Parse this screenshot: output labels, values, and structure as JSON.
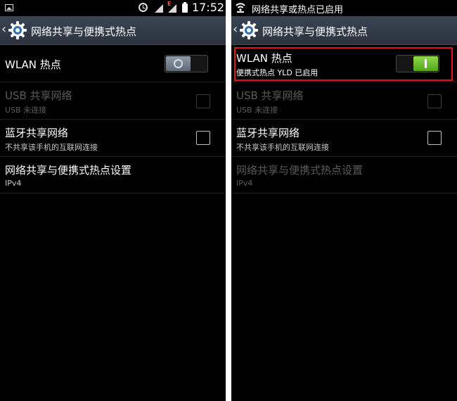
{
  "left_screen": {
    "status_bar": {
      "time": "17:52",
      "network_label": "E",
      "icons": [
        "image-notification-icon",
        "alarm-icon",
        "signal-icon",
        "battery-icon"
      ]
    },
    "action_bar": {
      "title": "网络共享与便携式热点",
      "icon": "gear-icon"
    },
    "rows": [
      {
        "title": "WLAN 热点",
        "subtitle": "",
        "control": "toggle",
        "state": "off",
        "enabled": true
      },
      {
        "title": "USB 共享网络",
        "subtitle": "USB 未连接",
        "control": "checkbox",
        "checked": false,
        "enabled": false
      },
      {
        "title": "蓝牙共享网络",
        "subtitle": "不共享该手机的互联网连接",
        "control": "checkbox",
        "checked": false,
        "enabled": true
      },
      {
        "title": "网络共享与便携式热点设置",
        "subtitle": "IPv4",
        "control": "none",
        "enabled": true
      }
    ]
  },
  "right_screen": {
    "status_bar": {
      "notification_text": "网络共享或热点已启用",
      "icon": "wifi-hotspot-icon"
    },
    "action_bar": {
      "title": "网络共享与便携式热点",
      "icon": "gear-icon"
    },
    "rows": [
      {
        "title": "WLAN 热点",
        "subtitle": "便携式热点 YLD 已启用",
        "control": "toggle",
        "state": "on",
        "enabled": true
      },
      {
        "title": "USB 共享网络",
        "subtitle": "USB 未连接",
        "control": "checkbox",
        "checked": false,
        "enabled": false
      },
      {
        "title": "蓝牙共享网络",
        "subtitle": "不共享该手机的互联网连接",
        "control": "checkbox",
        "checked": false,
        "enabled": true
      },
      {
        "title": "网络共享与便携式热点设置",
        "subtitle": "IPv4",
        "control": "none",
        "enabled": false
      }
    ]
  },
  "colors": {
    "background": "#000000",
    "action_bar": "#343d49",
    "toggle_on": "#6cc72e",
    "toggle_off": "#7a8796",
    "highlight": "#e3141b",
    "disabled_text": "#5a5a5a"
  }
}
